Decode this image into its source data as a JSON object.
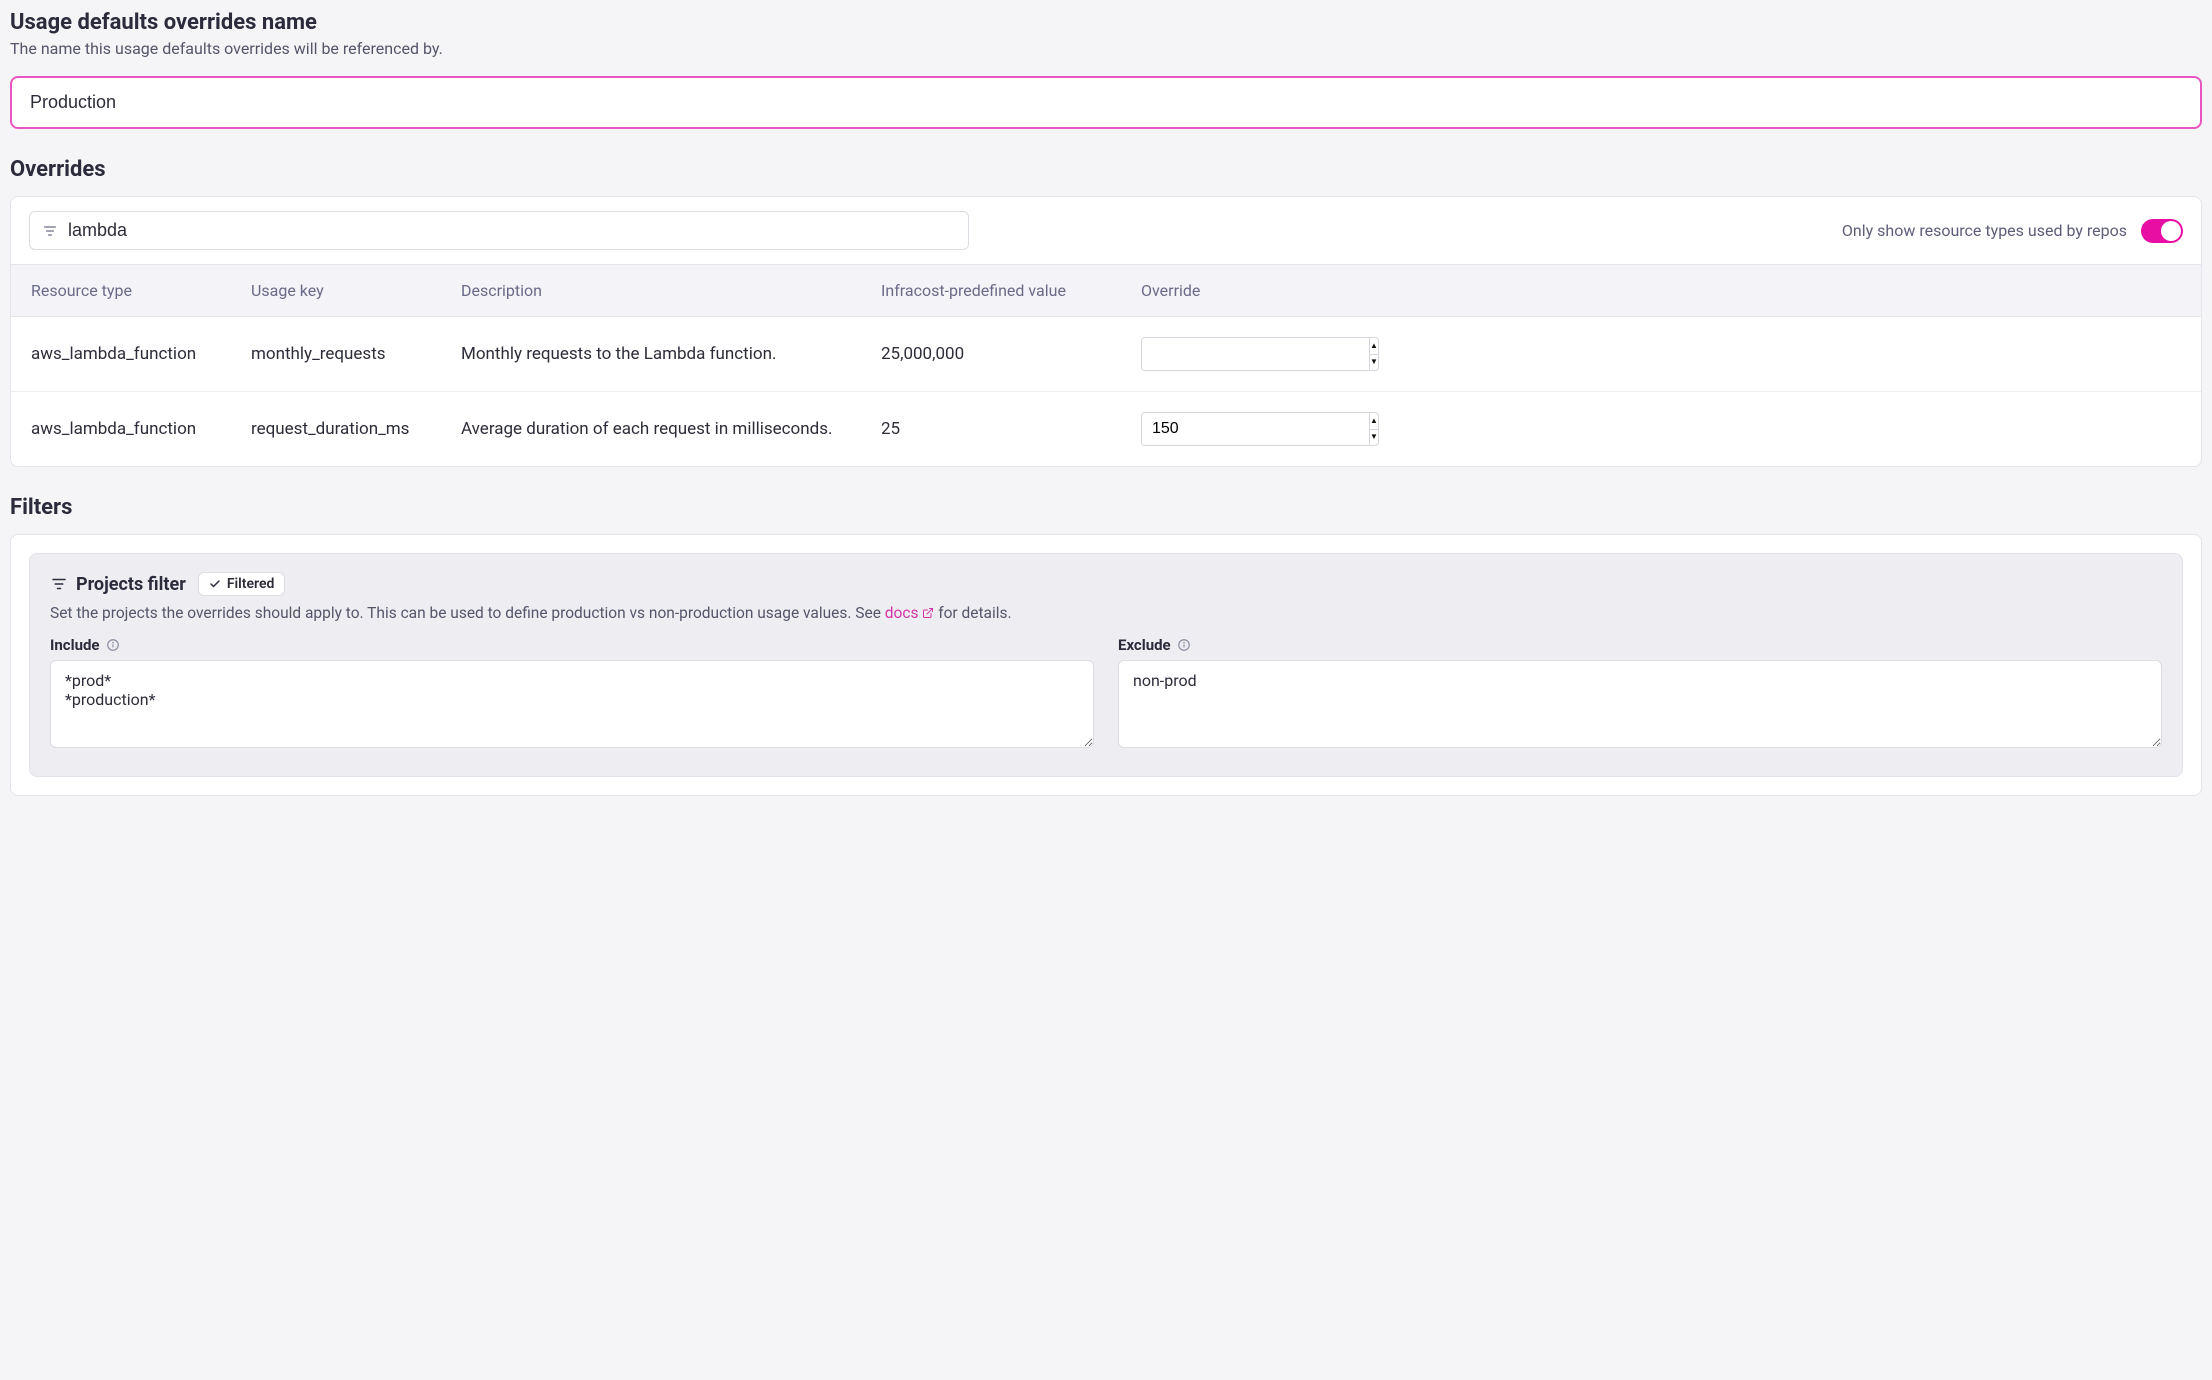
{
  "name_section": {
    "title": "Usage defaults overrides name",
    "subtitle": "The name this usage defaults overrides will be referenced by.",
    "value": "Production"
  },
  "overrides": {
    "title": "Overrides",
    "filter_value": "lambda",
    "toggle_label": "Only show resource types used by repos",
    "columns": {
      "resource_type": "Resource type",
      "usage_key": "Usage key",
      "description": "Description",
      "predefined": "Infracost-predefined value",
      "override": "Override"
    },
    "rows": [
      {
        "resource_type": "aws_lambda_function",
        "usage_key": "monthly_requests",
        "description": "Monthly requests to the Lambda function.",
        "predefined": "25,000,000",
        "override": ""
      },
      {
        "resource_type": "aws_lambda_function",
        "usage_key": "request_duration_ms",
        "description": "Average duration of each request in milliseconds.",
        "predefined": "25",
        "override": "150"
      }
    ]
  },
  "filters": {
    "title": "Filters",
    "projects_filter_title": "Projects filter",
    "filtered_badge": "Filtered",
    "description_pre": "Set the projects the overrides should apply to. This can be used to define production vs non-production usage values. See ",
    "docs_label": "docs",
    "description_post": " for details.",
    "include_label": "Include",
    "exclude_label": "Exclude",
    "include_value": "*prod*\n*production*",
    "exclude_value": "non-prod"
  }
}
